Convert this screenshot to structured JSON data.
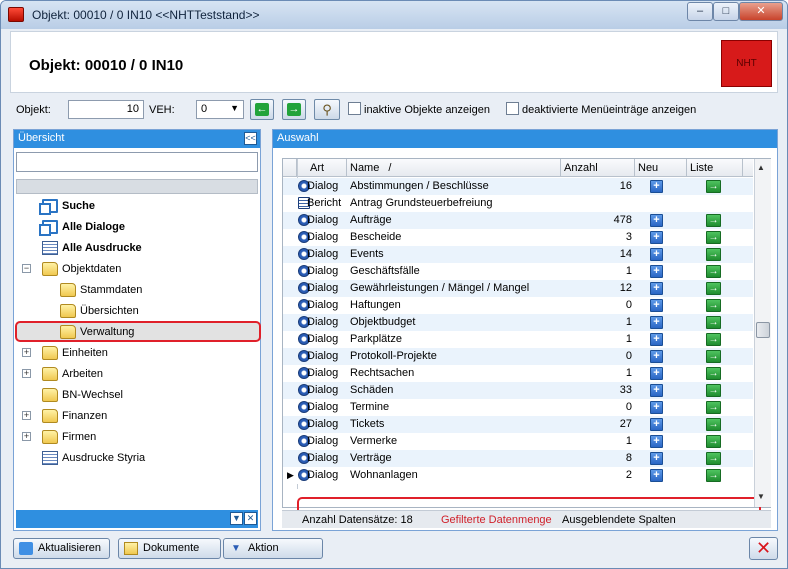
{
  "window": {
    "title": "Objekt: 00010 / 0  IN10  <<NHTTeststand>>",
    "controls": {
      "minimize": "–",
      "maximize": "□",
      "close": "✕"
    }
  },
  "header": {
    "title": "Objekt: 00010 / 0  IN10",
    "logo_text": "NHT"
  },
  "toolbar": {
    "objekt_label": "Objekt:",
    "objekt_value": "10",
    "veh_label": "VEH:",
    "veh_value": "0",
    "inactive_label": "inaktive Objekte anzeigen",
    "deactivated_label": "deaktivierte Menüeinträge anzeigen"
  },
  "left": {
    "title": "Übersicht",
    "collapse": "<<",
    "tree": [
      {
        "label": "Suche",
        "bold": true,
        "icon": "pages-icon"
      },
      {
        "label": "Alle Dialoge",
        "bold": true,
        "icon": "pages-icon"
      },
      {
        "label": "Alle Ausdrucke",
        "bold": true,
        "icon": "document-icon"
      },
      {
        "label": "Objektdaten",
        "bold": false,
        "icon": "folder-icon",
        "expander": "−"
      },
      {
        "label": "Stammdaten",
        "bold": false,
        "icon": "folder-icon"
      },
      {
        "label": "Übersichten",
        "bold": false,
        "icon": "folder-icon"
      },
      {
        "label": "Verwaltung",
        "bold": false,
        "icon": "folder-icon"
      },
      {
        "label": "Einheiten",
        "bold": false,
        "icon": "folder-icon",
        "expander": "+"
      },
      {
        "label": "Arbeiten",
        "bold": false,
        "icon": "folder-icon",
        "expander": "+"
      },
      {
        "label": "BN-Wechsel",
        "bold": false,
        "icon": "folder-icon"
      },
      {
        "label": "Finanzen",
        "bold": false,
        "icon": "folder-icon",
        "expander": "+"
      },
      {
        "label": "Firmen",
        "bold": false,
        "icon": "folder-icon",
        "expander": "+"
      },
      {
        "label": "Ausdrucke Styria",
        "bold": false,
        "icon": "document-icon"
      }
    ]
  },
  "right": {
    "title": "Auswahl",
    "columns": {
      "art": "Art",
      "name": "Name",
      "sort_mark": "/",
      "anzahl": "Anzahl",
      "neu": "Neu",
      "liste": "Liste"
    },
    "rows": [
      {
        "art": "Dialog",
        "name": "Abstimmungen / Beschlüsse",
        "anzahl": "16",
        "neu": true,
        "liste": true
      },
      {
        "art": "Bericht",
        "name": "Antrag Grundsteuerbefreiung",
        "anzahl": "",
        "neu": false,
        "liste": false
      },
      {
        "art": "Dialog",
        "name": "Aufträge",
        "anzahl": "478",
        "neu": true,
        "liste": true
      },
      {
        "art": "Dialog",
        "name": "Bescheide",
        "anzahl": "3",
        "neu": true,
        "liste": true
      },
      {
        "art": "Dialog",
        "name": "Events",
        "anzahl": "14",
        "neu": true,
        "liste": true
      },
      {
        "art": "Dialog",
        "name": "Geschäftsfälle",
        "anzahl": "1",
        "neu": true,
        "liste": true
      },
      {
        "art": "Dialog",
        "name": "Gewährleistungen / Mängel / Mangel",
        "anzahl": "12",
        "neu": true,
        "liste": true
      },
      {
        "art": "Dialog",
        "name": "Haftungen",
        "anzahl": "0",
        "neu": true,
        "liste": true
      },
      {
        "art": "Dialog",
        "name": "Objektbudget",
        "anzahl": "1",
        "neu": true,
        "liste": true
      },
      {
        "art": "Dialog",
        "name": "Parkplätze",
        "anzahl": "1",
        "neu": true,
        "liste": true
      },
      {
        "art": "Dialog",
        "name": "Protokoll-Projekte",
        "anzahl": "0",
        "neu": true,
        "liste": true
      },
      {
        "art": "Dialog",
        "name": "Rechtsachen",
        "anzahl": "1",
        "neu": true,
        "liste": true
      },
      {
        "art": "Dialog",
        "name": "Schäden",
        "anzahl": "33",
        "neu": true,
        "liste": true
      },
      {
        "art": "Dialog",
        "name": "Termine",
        "anzahl": "0",
        "neu": true,
        "liste": true
      },
      {
        "art": "Dialog",
        "name": "Tickets",
        "anzahl": "27",
        "neu": true,
        "liste": true
      },
      {
        "art": "Dialog",
        "name": "Vermerke",
        "anzahl": "1",
        "neu": true,
        "liste": true
      },
      {
        "art": "Dialog",
        "name": "Verträge",
        "anzahl": "8",
        "neu": true,
        "liste": true
      },
      {
        "art": "Dialog",
        "name": "Wohnanlagen",
        "anzahl": "2",
        "neu": true,
        "liste": true
      }
    ],
    "status": {
      "count": "Anzahl Datensätze: 18",
      "filtered": "Gefilterte Datenmenge",
      "hidden": "Ausgeblendete Spalten"
    },
    "status_filtered_color": "#d0202a"
  },
  "bottom": {
    "refresh": "Aktualisieren",
    "documents": "Dokumente",
    "action": "Aktion"
  }
}
